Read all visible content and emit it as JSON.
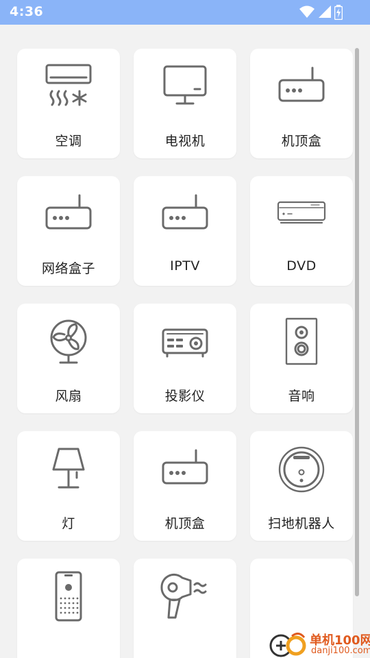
{
  "status_bar": {
    "time": "4:36",
    "background": "#8ab4f8"
  },
  "devices": [
    {
      "label": "空调",
      "icon": "air-conditioner-icon"
    },
    {
      "label": "电视机",
      "icon": "tv-icon"
    },
    {
      "label": "机顶盒",
      "icon": "set-top-box-icon"
    },
    {
      "label": "网络盒子",
      "icon": "network-box-icon"
    },
    {
      "label": "IPTV",
      "icon": "iptv-icon"
    },
    {
      "label": "DVD",
      "icon": "dvd-icon"
    },
    {
      "label": "风扇",
      "icon": "fan-icon"
    },
    {
      "label": "投影仪",
      "icon": "projector-icon"
    },
    {
      "label": "音响",
      "icon": "speaker-icon"
    },
    {
      "label": "灯",
      "icon": "lamp-icon"
    },
    {
      "label": "机顶盒",
      "icon": "set-top-box-icon"
    },
    {
      "label": "扫地机器人",
      "icon": "robot-vacuum-icon"
    },
    {
      "label": "",
      "icon": "remote-control-icon"
    },
    {
      "label": "",
      "icon": "hair-dryer-icon"
    },
    {
      "label": "",
      "icon": ""
    }
  ],
  "watermark": {
    "title": "单机100网",
    "url": "danji100.com"
  }
}
